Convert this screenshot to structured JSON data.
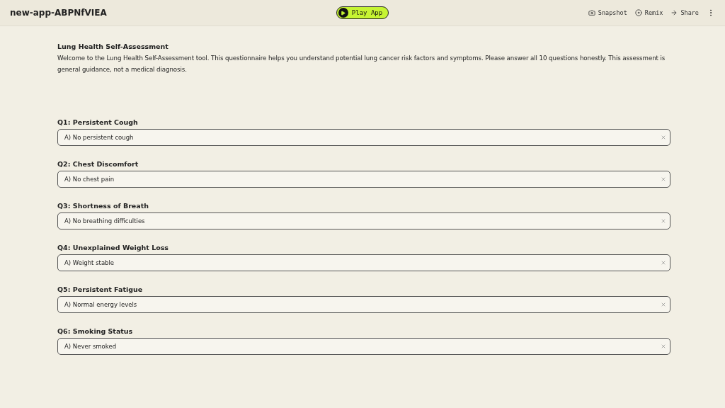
{
  "header": {
    "app_name": "new-app-ABPNfVIEA",
    "play_button": "Play App",
    "actions": [
      "Snapshot",
      "Remix",
      "Share"
    ]
  },
  "form": {
    "title": "Lung Health Self-Assessment",
    "intro": "Welcome to the Lung Health Self-Assessment tool. This questionnaire helps you understand potential lung cancer risk factors and symptoms. Please answer all 10 questions honestly. This assessment is general guidance, not a medical diagnosis.",
    "questions": [
      {
        "label": "Q1: Persistent Cough",
        "value": "A) No persistent cough"
      },
      {
        "label": "Q2: Chest Discomfort",
        "value": "A) No chest pain"
      },
      {
        "label": "Q3: Shortness of Breath",
        "value": "A) No breathing difficulties"
      },
      {
        "label": "Q4: Unexplained Weight Loss",
        "value": "A) Weight stable"
      },
      {
        "label": "Q5: Persistent Fatigue",
        "value": "A) Normal energy levels"
      },
      {
        "label": "Q6: Smoking Status",
        "value": "A) Never smoked"
      }
    ]
  }
}
